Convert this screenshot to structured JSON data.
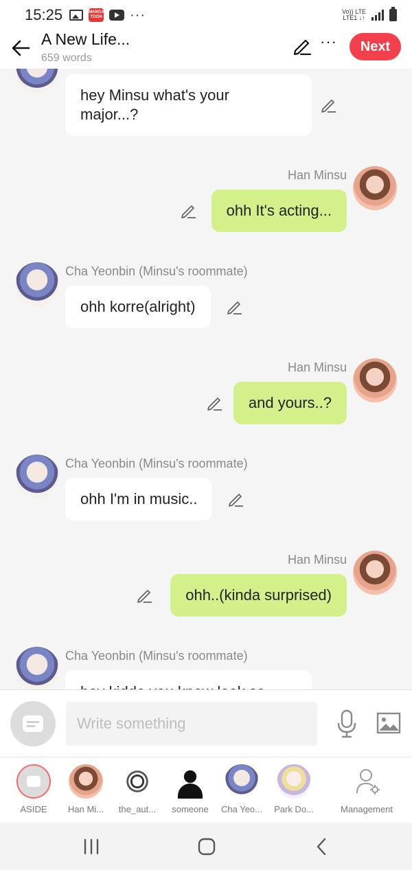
{
  "status_bar": {
    "time": "15:25",
    "manga_badge": "MANGA TOON",
    "network_top": "Vo)) LTE",
    "network_bottom": "LTE1 ↓↑"
  },
  "header": {
    "title": "A New Life...",
    "subtitle": "659 words",
    "next_label": "Next"
  },
  "messages": [
    {
      "side": "left",
      "speaker": "",
      "avatar": "cha-yeonbin",
      "text_line1": "hey Minsu what's your",
      "text_line2": "major...?"
    },
    {
      "side": "right",
      "speaker": "Han Minsu",
      "avatar": "han-minsu",
      "text": "ohh It's acting..."
    },
    {
      "side": "left",
      "speaker": "Cha Yeonbin (Minsu's roommate)",
      "avatar": "cha-yeonbin",
      "text": "ohh korre(alright)"
    },
    {
      "side": "right",
      "speaker": "Han Minsu",
      "avatar": "han-minsu",
      "text": "and yours..?"
    },
    {
      "side": "left",
      "speaker": "Cha Yeonbin (Minsu's roommate)",
      "avatar": "cha-yeonbin",
      "text": "ohh I'm in music.."
    },
    {
      "side": "right",
      "speaker": "Han Minsu",
      "avatar": "han-minsu",
      "text": "ohh..(kinda surprised)"
    },
    {
      "side": "left",
      "speaker": "Cha Yeonbin (Minsu's roommate)",
      "avatar": "cha-yeonbin",
      "text": "hey kiddo you know look so"
    }
  ],
  "composer": {
    "placeholder": "Write something"
  },
  "characters": [
    {
      "label": "ASIDE"
    },
    {
      "label": "Han Mi..."
    },
    {
      "label": "the_aut..."
    },
    {
      "label": "someone"
    },
    {
      "label": "Cha Yeo..."
    },
    {
      "label": "Park Do..."
    }
  ],
  "management": {
    "label": "Management"
  },
  "colors": {
    "accent": "#f43f4c",
    "right_bubble": "#d3f08b",
    "left_bubble": "#ffffff"
  }
}
